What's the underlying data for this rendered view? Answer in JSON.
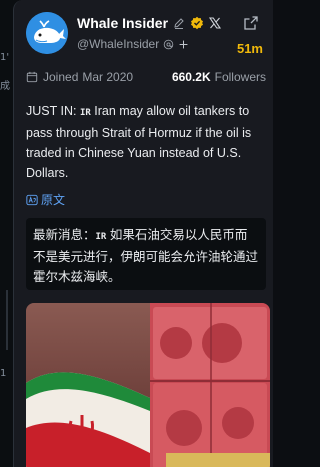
{
  "background": {
    "side_texts": [
      "1'",
      "成",
      "1"
    ]
  },
  "profile": {
    "name": "Whale Insider",
    "handle": "@WhaleInsider",
    "time_ago": "51m",
    "joined_label": "Joined",
    "joined_date": "Mar 2020",
    "followers_count": "660.2K",
    "followers_label": "Followers"
  },
  "post": {
    "lead": "JUST IN: ",
    "flag_code": "IR",
    "text": " Iran may allow oil tankers to pass through Strait of Hormuz if the oil is traded in Chinese Yuan instead of U.S. Dollars.",
    "original_label": "原文"
  },
  "translation": {
    "lead": "最新消息：",
    "flag_code": "IR",
    "text": " 如果石油交易以人民币而不是美元进行，伊朗可能会允许油轮通过霍尔木兹海峡。"
  },
  "colors": {
    "accent": "#f0b90b",
    "link": "#5fa3f5",
    "card": "#181a20",
    "muted": "#9aa0a8"
  },
  "icons": [
    "pencil-icon",
    "verified-badge-icon",
    "x-logo-icon",
    "share-icon",
    "calendar-icon",
    "translate-icon",
    "at-icon",
    "plus-icon"
  ]
}
